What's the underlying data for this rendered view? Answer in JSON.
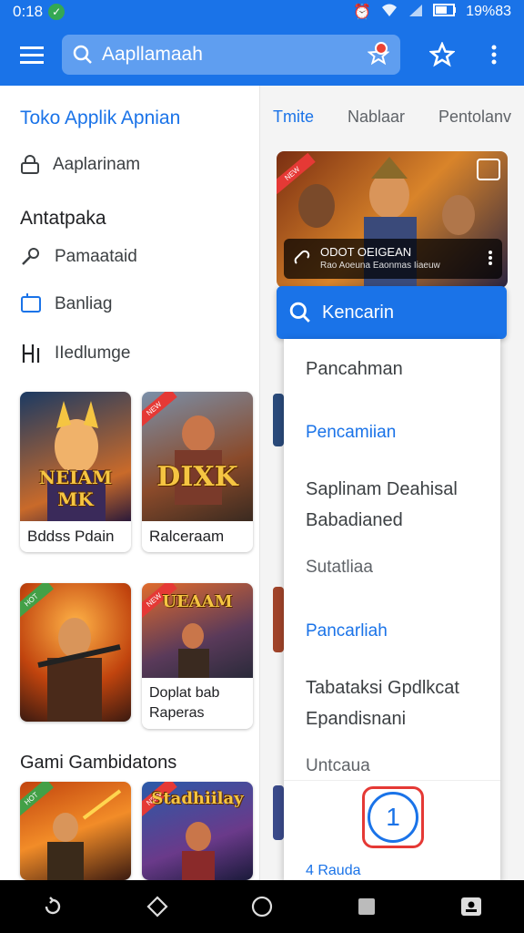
{
  "status_bar": {
    "time": "0:18",
    "right_text": "19%83"
  },
  "app_bar": {
    "search_text": "Aapllamaah"
  },
  "left": {
    "header": "Toko Applik Apnian",
    "item_apps": "Aaplarinam",
    "section2": "Antatpaka",
    "nav": [
      {
        "label": "Pamaataid",
        "icon": "key-icon"
      },
      {
        "label": "Banliag",
        "icon": "thumbs-up-icon"
      },
      {
        "label": "IIedlumge",
        "icon": "bracket-icon"
      }
    ],
    "cards_row1": [
      {
        "label": "Bddss Pdain",
        "art": "NEIAM MK"
      },
      {
        "label": "Ralceraam",
        "art": "DIXK"
      }
    ],
    "cards_row2": [
      {
        "label": "Doplat bab Raperas",
        "art": "UEAAM"
      }
    ],
    "section3": "Gami Gambidatons",
    "cards_row3": [
      {
        "label": "",
        "art": "Stadhiilay"
      }
    ]
  },
  "right": {
    "tabs": [
      "Tmite",
      "Nablaar",
      "Pentolanv"
    ],
    "hero_caption": "ODOT OEIGEAN",
    "hero_sub": "Rao Aoeuna Eaonmas Iiaeuw",
    "dropdown_title": "Kencarin",
    "dropdown_items": [
      {
        "text": "Pancahman",
        "style": "normal"
      },
      {
        "text": "Pencamiian",
        "style": "blue"
      },
      {
        "text": "Saplinam Deahisal Babadianed",
        "style": "normal"
      },
      {
        "text": "Sutatliaa",
        "style": "muted"
      },
      {
        "text": "Pancarliah",
        "style": "blue"
      },
      {
        "text": "Tabataksi Gpdlkcat Epandisnani",
        "style": "normal"
      },
      {
        "text": "Untcaua",
        "style": "muted"
      }
    ],
    "dropdown_button_label": "1",
    "dropdown_footer": "4 Rauda"
  },
  "colors": {
    "primary": "#1a73e8",
    "accent_red": "#e53935",
    "nav_bg": "#000000"
  }
}
